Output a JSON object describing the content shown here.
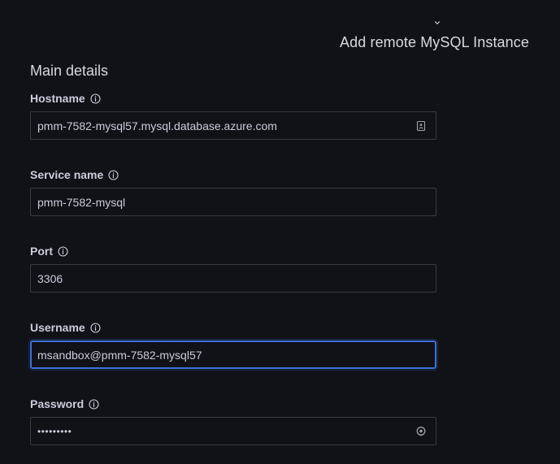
{
  "header": {
    "title": "Add remote MySQL Instance",
    "collapse_icon": "chevron-down-icon"
  },
  "section": {
    "title": "Main details"
  },
  "fields": {
    "hostname": {
      "label": "Hostname",
      "value": "pmm-7582-mysql57.mysql.database.azure.com",
      "label_icon": "info-icon",
      "suffix_icon": "contact-card-icon"
    },
    "service_name": {
      "label": "Service name",
      "value": "pmm-7582-mysql",
      "label_icon": "info-icon"
    },
    "port": {
      "label": "Port",
      "value": "3306",
      "label_icon": "info-icon"
    },
    "username": {
      "label": "Username",
      "value": "msandbox@pmm-7582-mysql57",
      "label_icon": "info-icon",
      "focused": true
    },
    "password": {
      "label": "Password",
      "value": "•••••••••",
      "label_icon": "info-icon",
      "suffix_icon": "eye-icon"
    }
  },
  "colors": {
    "background": "#111217",
    "text": "#ccccdc",
    "focus_border": "#3d71d9"
  }
}
